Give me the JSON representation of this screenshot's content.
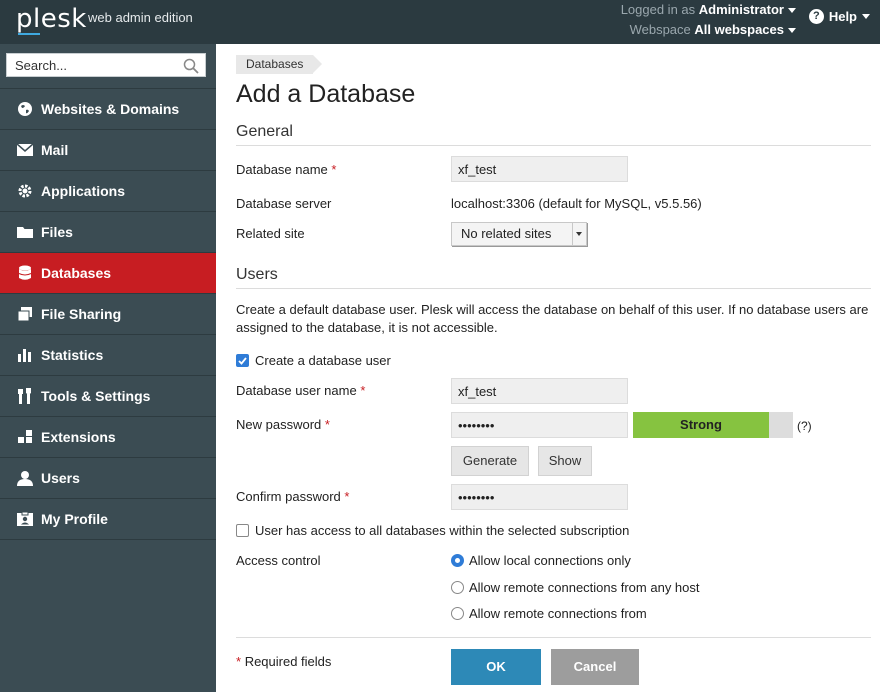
{
  "topbar": {
    "logo": "plesk",
    "edition": "web admin edition",
    "logged_in_label": "Logged in as",
    "logged_in_value": "Administrator",
    "webspace_label": "Webspace",
    "webspace_value": "All webspaces",
    "help_label": "Help",
    "accent_color": "#3fa9e0"
  },
  "sidebar": {
    "search_placeholder": "Search...",
    "items": [
      {
        "label": "Websites & Domains",
        "icon": "globe-icon"
      },
      {
        "label": "Mail",
        "icon": "envelope-icon"
      },
      {
        "label": "Applications",
        "icon": "gear-icon"
      },
      {
        "label": "Files",
        "icon": "folder-icon"
      },
      {
        "label": "Databases",
        "icon": "database-icon",
        "active": true
      },
      {
        "label": "File Sharing",
        "icon": "file-share-icon"
      },
      {
        "label": "Statistics",
        "icon": "bar-chart-icon"
      },
      {
        "label": "Tools & Settings",
        "icon": "tools-icon"
      },
      {
        "label": "Extensions",
        "icon": "extensions-icon"
      },
      {
        "label": "Users",
        "icon": "user-icon"
      },
      {
        "label": "My Profile",
        "icon": "profile-card-icon"
      }
    ],
    "active_color": "#c71d22"
  },
  "main": {
    "breadcrumb": "Databases",
    "title": "Add a Database",
    "general": {
      "heading": "General",
      "db_name_label": "Database name",
      "db_name_value": "xf_test",
      "db_server_label": "Database server",
      "db_server_value": "localhost:3306 (default for MySQL, v5.5.56)",
      "related_site_label": "Related site",
      "related_site_value": "No related sites"
    },
    "users": {
      "heading": "Users",
      "description": "Create a default database user. Plesk will access the database on behalf of this user. If no database users are assigned to the database, it is not accessible.",
      "create_user_label": "Create a database user",
      "create_user_checked": true,
      "user_name_label": "Database user name",
      "user_name_value": "xf_test",
      "new_password_label": "New password",
      "new_password_value": "••••••••",
      "strength_label": "Strong",
      "strength_fraction": 0.85,
      "strength_help": "(?)",
      "generate_label": "Generate",
      "show_label": "Show",
      "confirm_password_label": "Confirm password",
      "confirm_password_value": "••••••••",
      "all_db_access_label": "User has access to all databases within the selected subscription",
      "all_db_access_checked": false,
      "access_control_label": "Access control",
      "access_options": [
        {
          "label": "Allow local connections only",
          "selected": true
        },
        {
          "label": "Allow remote connections from any host",
          "selected": false
        },
        {
          "label": "Allow remote connections from",
          "selected": false
        }
      ]
    },
    "required_fields_note": "Required fields",
    "required_star": "*",
    "ok_label": "OK",
    "cancel_label": "Cancel"
  }
}
